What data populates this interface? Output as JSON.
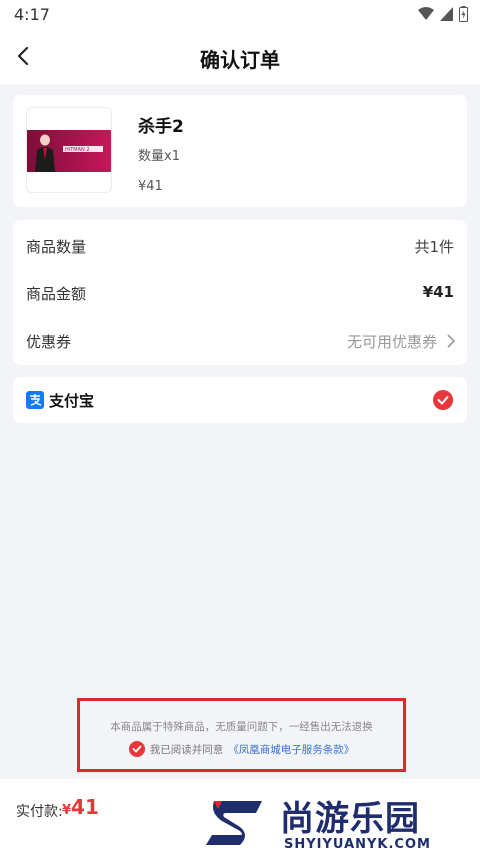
{
  "status_bar": {
    "time": "4:17"
  },
  "header": {
    "title": "确认订单"
  },
  "product": {
    "name": "杀手2",
    "quantity": "数量x1",
    "price": "¥41",
    "thumb_text": "HITMAN 2"
  },
  "summary": {
    "rows": [
      {
        "label": "商品数量",
        "value": "共1件"
      },
      {
        "label": "商品金额",
        "value": "¥41"
      },
      {
        "label": "优惠券",
        "value": "无可用优惠券"
      }
    ]
  },
  "payment": {
    "method": "支付宝",
    "icon": "alipay-icon",
    "selected": true
  },
  "notice": {
    "text": "本商品属于特殊商品，无质量问题下，一经售出无法退换",
    "agree_prefix": "我已阅读并同意",
    "agree_link": "《凤凰商城电子服务条款》"
  },
  "footer": {
    "total_label": "实付款:",
    "currency": "¥",
    "total_value": "41"
  },
  "watermark": {
    "brand": "尚游乐园",
    "domain": "SHYIYUANYK.COM"
  },
  "colors": {
    "accent": "#e8363b",
    "link": "#3b6fd6",
    "alipay": "#1677ff",
    "watermark": "#1f2d6d"
  }
}
